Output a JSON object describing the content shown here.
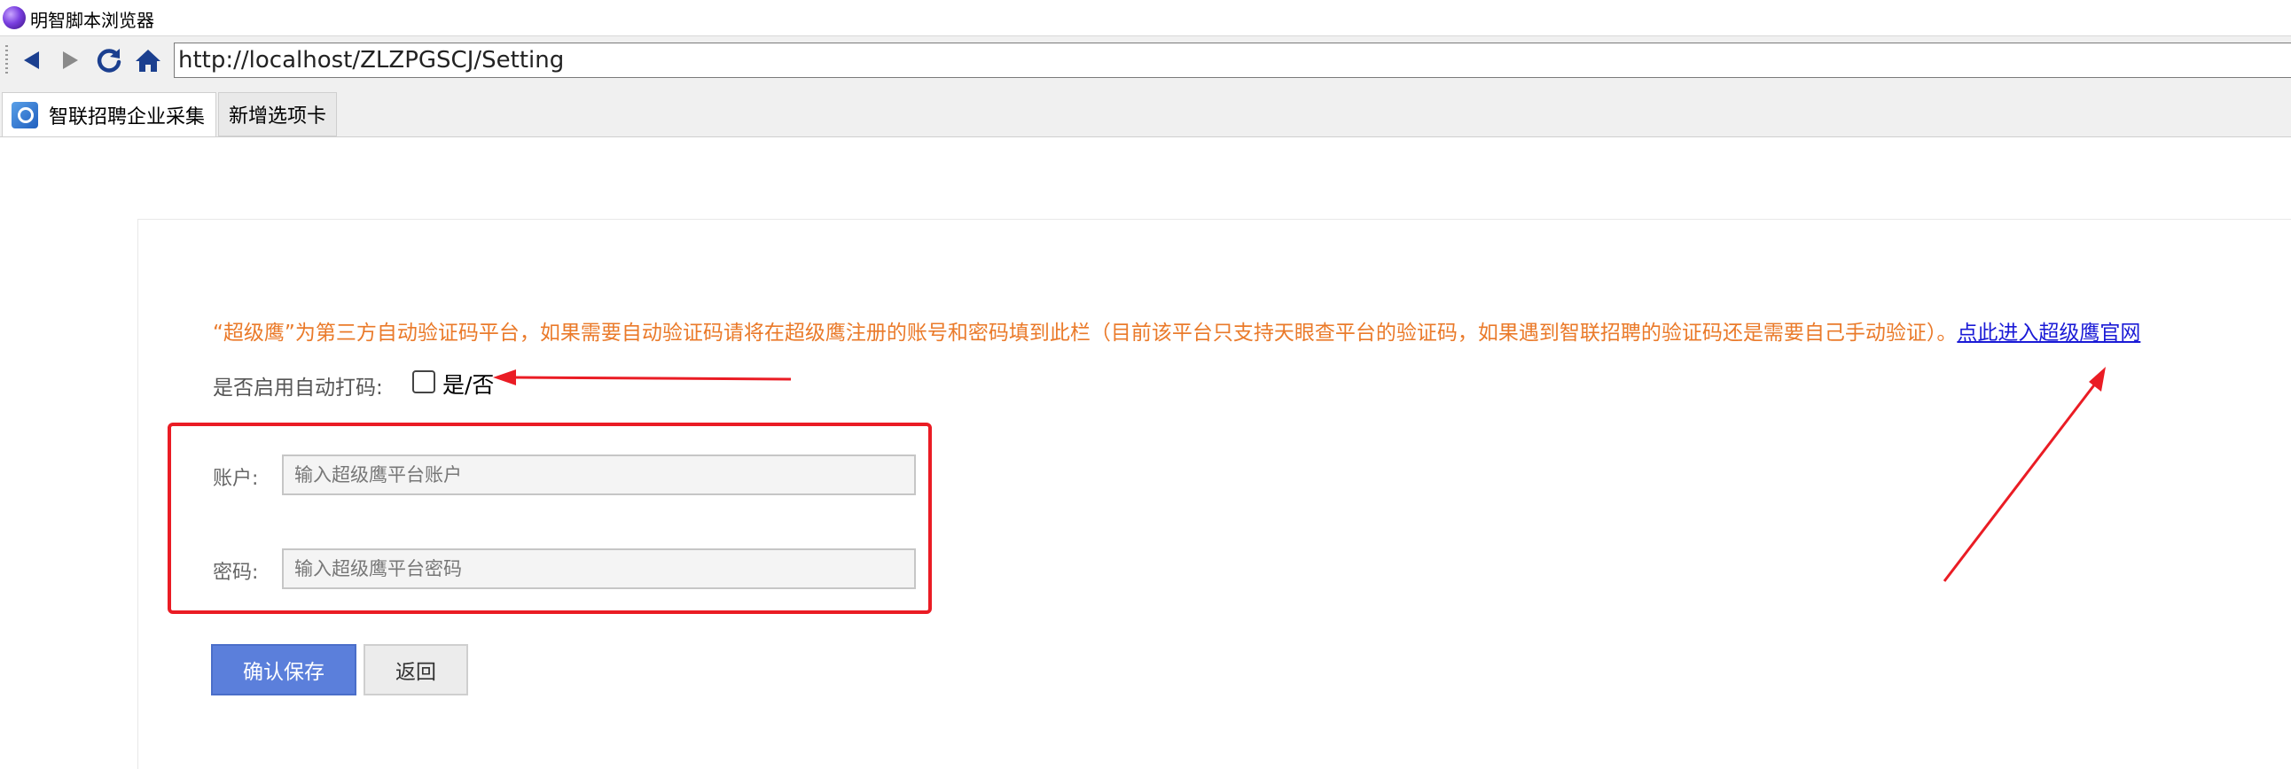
{
  "window": {
    "title": "明智脚本浏览器",
    "icon": "app-orb-icon"
  },
  "navbar": {
    "url": "http://localhost/ZLZPGSCJ/Setting",
    "buttons": [
      "back-icon",
      "forward-icon",
      "refresh-icon",
      "home-icon"
    ]
  },
  "tabs": [
    {
      "label": "智联招聘企业采集",
      "active": true,
      "icon": "search-page-icon"
    },
    {
      "label": "新增选项卡",
      "active": false
    }
  ],
  "settings": {
    "notice_text": "“超级鹰”为第三方自动验证码平台，如果需要自动验证码请将在超级鹰注册的账号和密码填到此栏（目前该平台只支持天眼查平台的验证码，如果遇到智联招聘的验证码还是需要自己手动验证）。",
    "notice_link": "点此进入超级鹰官网",
    "auto_captcha_label": "是否启用自动打码:",
    "auto_captcha_toggle": "是/否",
    "auto_captcha_checked": false,
    "account_label": "账户:",
    "account_placeholder": "输入超级鹰平台账户",
    "account_value": "",
    "password_label": "密码:",
    "password_placeholder": "输入超级鹰平台密码",
    "password_value": "",
    "save_button": "确认保存",
    "back_button": "返回"
  },
  "colors": {
    "notice": "#ea7a2a",
    "link": "#1a1ad6",
    "highlight_box": "#ea1c24",
    "save_button": "#5b7fdb"
  }
}
